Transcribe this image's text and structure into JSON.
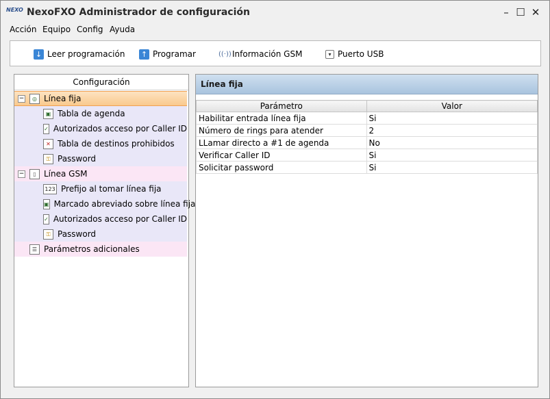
{
  "window": {
    "logo_text": "NEXO",
    "title": "NexoFXO Administrador de configuración",
    "controls": [
      "–",
      "☐",
      "✕"
    ]
  },
  "menu": [
    "Acción",
    "Equipo",
    "Config",
    "Ayuda"
  ],
  "toolbar": {
    "read_label": "Leer programación",
    "program_label": "Programar",
    "gsm_label": "Información GSM",
    "usb_label": "Puerto USB"
  },
  "tree": {
    "header": "Configuración",
    "linea_fija": "Línea fija",
    "linea_fija_children": [
      "Tabla de agenda",
      "Autorizados acceso por Caller ID",
      "Tabla de destinos prohibidos",
      "Password"
    ],
    "linea_gsm": "Línea GSM",
    "linea_gsm_children": [
      "Prefijo al tomar línea fija",
      "Marcado abreviado sobre línea fija",
      "Autorizados acceso por Caller ID",
      "Password"
    ],
    "extra": "Parámetros adicionales"
  },
  "detail": {
    "title": "Línea fija",
    "col_param": "Parámetro",
    "col_value": "Valor",
    "rows": [
      {
        "param": "Habilitar entrada línea fija",
        "value": "Si"
      },
      {
        "param": "Número de rings para atender",
        "value": "2"
      },
      {
        "param": "LLamar directo a #1 de agenda",
        "value": "No"
      },
      {
        "param": "Verificar Caller ID",
        "value": "Si"
      },
      {
        "param": "Solicitar password",
        "value": "Si"
      }
    ]
  },
  "colors": {
    "selection": "#f9c98d",
    "panel_header": "#a9c4de",
    "gsm_bg": "#fbe6f5",
    "child_bg": "#e9e7f8"
  }
}
